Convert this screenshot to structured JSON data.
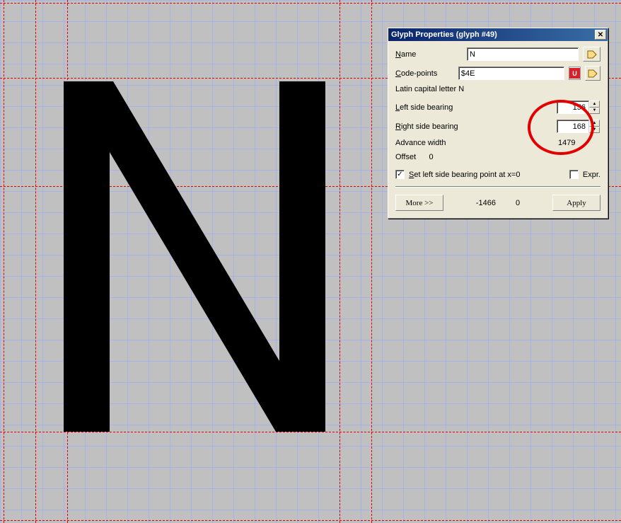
{
  "dialog": {
    "title": "Glyph Properties (glyph #49)",
    "name_label": "Name",
    "name_value": "N",
    "codepoints_label": "Code-points",
    "codepoints_value": "$4E",
    "description": "Latin capital letter N",
    "lsb_label": "Left side bearing",
    "lsb_value": "156",
    "rsb_label": "Right side bearing",
    "rsb_value": "168",
    "advance_label": "Advance width",
    "advance_value": "1479",
    "offset_label": "Offset",
    "offset_value": "0",
    "set_lsb_label": "Set left side bearing point at x=0",
    "expr_label": "Expr.",
    "more_label": "More >>",
    "mid_val1": "-1466",
    "mid_val2": "0",
    "apply_label": "Apply"
  },
  "grid": {
    "spacing_px": 30,
    "guides_v": [
      5,
      50,
      95,
      480,
      525
    ],
    "guides_h": [
      4,
      110,
      263,
      610,
      735
    ]
  }
}
